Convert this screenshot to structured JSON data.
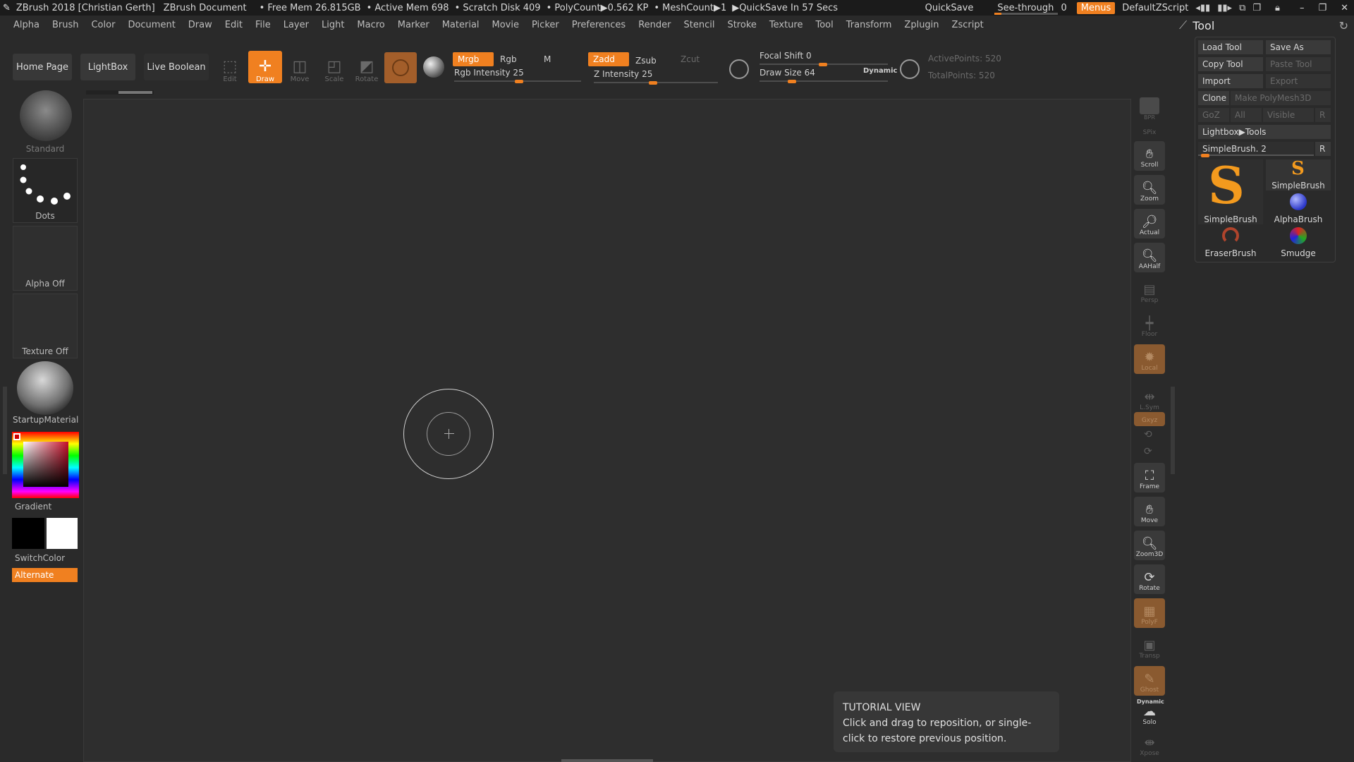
{
  "titlebar": {
    "app_title": "ZBrush 2018 [Christian Gerth]",
    "doc_title": "ZBrush Document",
    "free_mem": "• Free Mem 26.815GB",
    "active_mem": "• Active Mem 698",
    "scratch": "• Scratch Disk 409",
    "polycount": "• PolyCount▶0.562 KP",
    "meshcount": "• MeshCount▶1",
    "quicksave_in": "▶QuickSave In 57 Secs",
    "quicksave": "QuickSave",
    "see_through": "See-through",
    "see_through_value": "0",
    "menus": "Menus",
    "script": "DefaultZScript"
  },
  "menu": [
    "Alpha",
    "Brush",
    "Color",
    "Document",
    "Draw",
    "Edit",
    "File",
    "Layer",
    "Light",
    "Macro",
    "Marker",
    "Material",
    "Movie",
    "Picker",
    "Preferences",
    "Render",
    "Stencil",
    "Stroke",
    "Texture",
    "Tool",
    "Transform",
    "Zplugin",
    "Zscript"
  ],
  "toolbar": {
    "home_page": "Home Page",
    "lightbox": "LightBox",
    "live_boolean": "Live Boolean",
    "edit": "Edit",
    "draw": "Draw",
    "move": "Move",
    "scale": "Scale",
    "rotate": "Rotate",
    "mrgb": "Mrgb",
    "rgb": "Rgb",
    "m": "M",
    "zadd": "Zadd",
    "zsub": "Zsub",
    "zcut": "Zcut",
    "rgb_intensity": "Rgb Intensity 25",
    "z_intensity": "Z Intensity 25",
    "focal_shift": "Focal Shift 0",
    "draw_size": "Draw Size 64",
    "dynamic": "Dynamic",
    "active_points": "ActivePoints: 520",
    "total_points": "TotalPoints: 520",
    "rgb_intensity_value": 25,
    "z_intensity_value": 25,
    "focal_shift_value": 0,
    "draw_size_value": 64
  },
  "left_tray": {
    "brush": "Standard",
    "stroke": "Dots",
    "alpha": "Alpha Off",
    "texture": "Texture Off",
    "material": "StartupMaterial",
    "gradient": "Gradient",
    "switch_color": "SwitchColor",
    "alternate": "Alternate"
  },
  "right_shelf": [
    "BPR",
    "SPix",
    "Scroll",
    "Zoom",
    "Actual",
    "AAHalf",
    "Persp",
    "Floor",
    "Local",
    "L.Sym",
    "Gxyz",
    "Frame",
    "Move",
    "Zoom3D",
    "Rotate",
    "PolyF",
    "Transp",
    "Ghost",
    "Solo",
    "Xpose"
  ],
  "tool_panel": {
    "title": "Tool",
    "load_tool": "Load Tool",
    "save_as": "Save As",
    "copy_tool": "Copy Tool",
    "paste_tool": "Paste Tool",
    "import": "Import",
    "export": "Export",
    "clone": "Clone",
    "make_polymesh": "Make PolyMesh3D",
    "goz": "GoZ",
    "all": "All",
    "visible": "Visible",
    "r": "R",
    "lightbox_tools": "Lightbox▶Tools",
    "current_tool": "SimpleBrush. 2",
    "thumbs": [
      "SimpleBrush",
      "SimpleBrush",
      "AlphaBrush",
      "EraserBrush",
      "Smudge"
    ]
  },
  "tutorial": {
    "title": "TUTORIAL VIEW",
    "body": "Click and drag to reposition, or single-click to restore previous position."
  }
}
